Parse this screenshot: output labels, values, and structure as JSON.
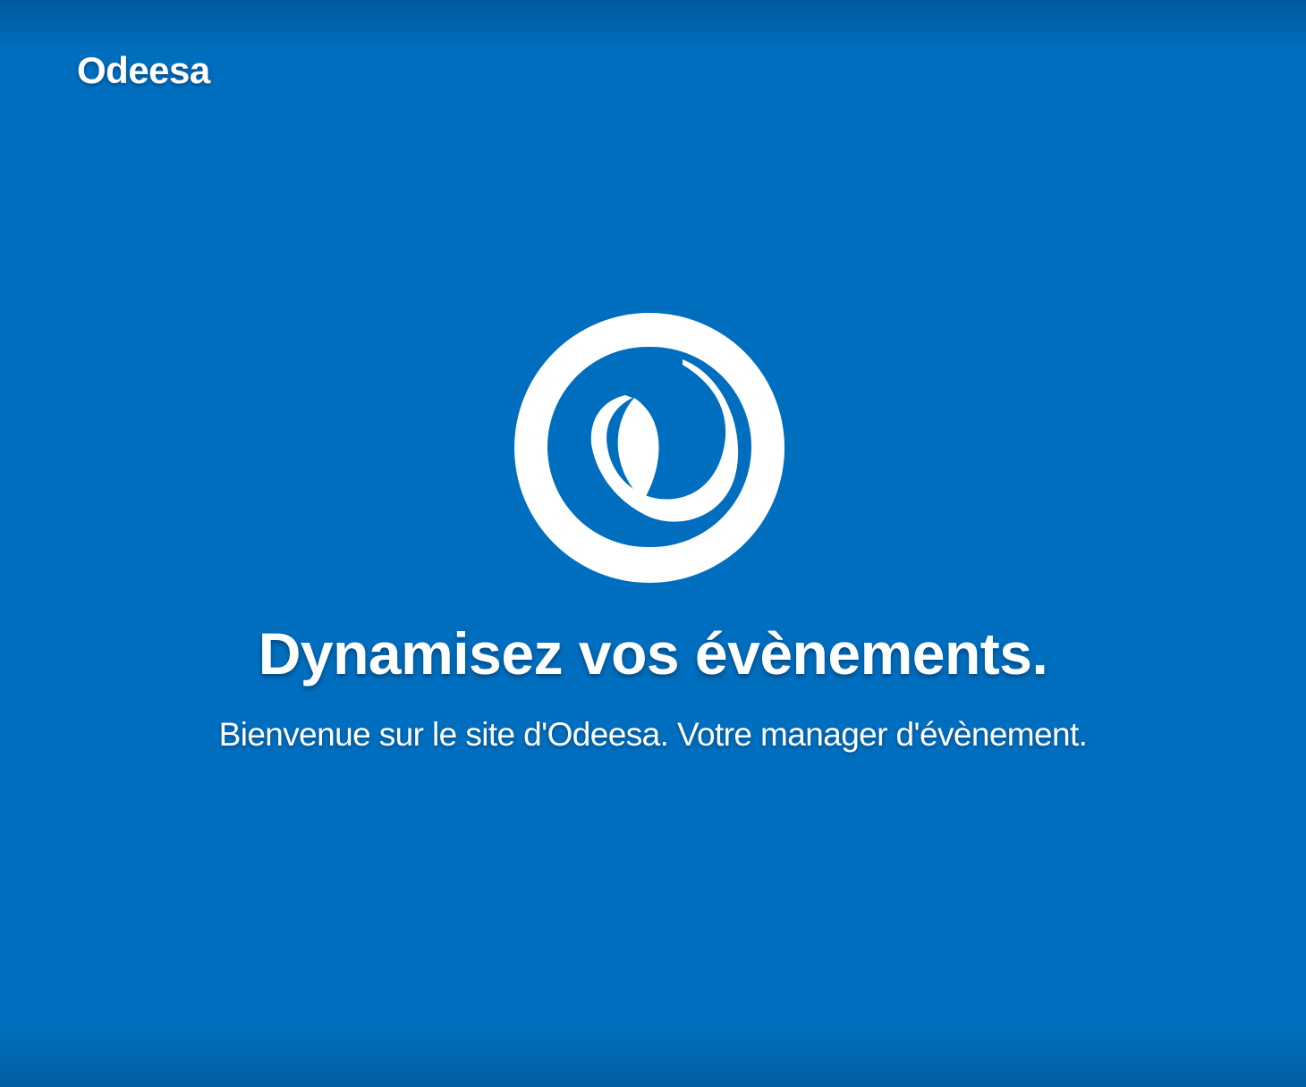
{
  "brand": {
    "name": "Odeesa"
  },
  "hero": {
    "logo_icon": "odeesa-logo-icon",
    "headline": "Dynamisez vos évènements.",
    "subtitle": "Bienvenue sur le site d'Odeesa. Votre manager d'évènement."
  },
  "colors": {
    "background": "#006ebf",
    "text": "#ffffff"
  }
}
